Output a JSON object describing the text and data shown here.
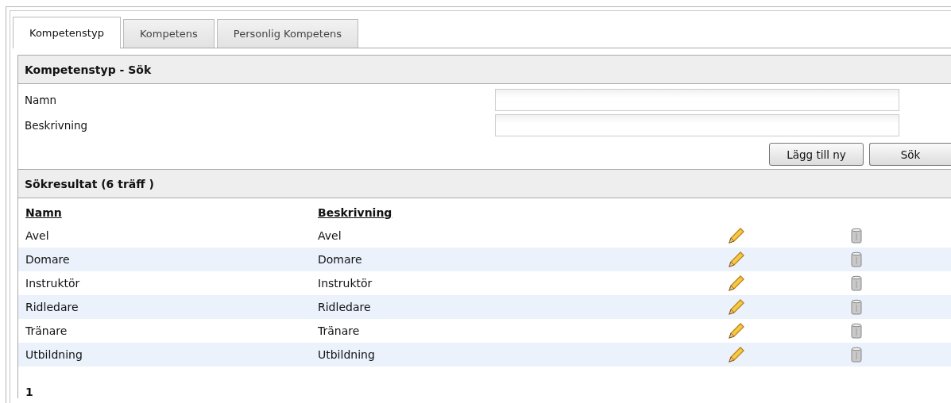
{
  "tabs": [
    {
      "label": "Kompetenstyp",
      "selected": true
    },
    {
      "label": "Kompetens",
      "selected": false
    },
    {
      "label": "Personlig Kompetens",
      "selected": false
    }
  ],
  "search": {
    "title": "Kompetenstyp - Sök",
    "fields": [
      {
        "label": "Namn"
      },
      {
        "label": "Beskrivning"
      }
    ],
    "buttons": [
      "Lägg till ny",
      "Sök"
    ]
  },
  "results": {
    "title": "Sökresultat (6 träff )",
    "columns": [
      "Namn",
      "Beskrivning"
    ],
    "rows": [
      {
        "name": "Avel",
        "description": "Avel"
      },
      {
        "name": "Domare",
        "description": "Domare"
      },
      {
        "name": "Instruktör",
        "description": "Instruktör"
      },
      {
        "name": "Ridledare",
        "description": "Ridledare"
      },
      {
        "name": "Tränare",
        "description": "Tränare"
      },
      {
        "name": "Utbildning",
        "description": "Utbildning"
      }
    ],
    "pages": [
      "1"
    ]
  }
}
